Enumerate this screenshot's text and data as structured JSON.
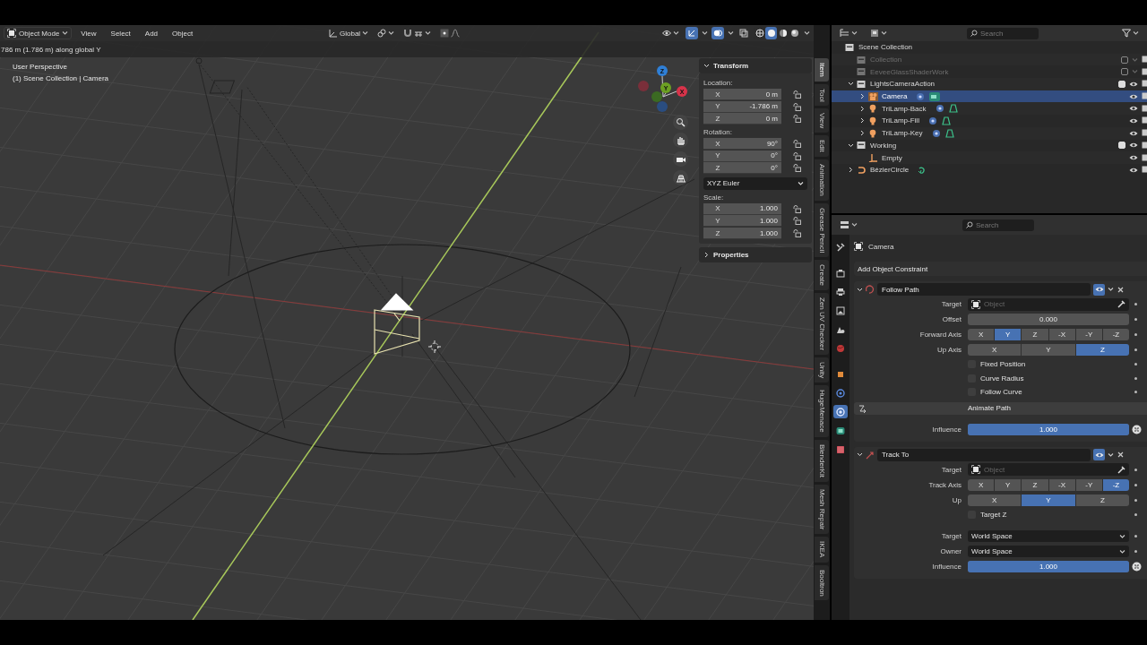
{
  "viewport_header": {
    "mode": "Object Mode",
    "menus": [
      "View",
      "Select",
      "Add",
      "Object"
    ],
    "orientation": "Global",
    "gizmos": {
      "on": true
    },
    "overlays": {
      "on": true
    },
    "xray": {
      "on": false
    },
    "shading": [
      {
        "kind": "wireframe",
        "selected": false
      },
      {
        "kind": "solid",
        "selected": true
      },
      {
        "kind": "material",
        "selected": false
      },
      {
        "kind": "rendered",
        "selected": false
      }
    ]
  },
  "viewport": {
    "operator_text": "786 m (1.786 m) along global Y",
    "view_name": "User Perspective",
    "view_context": "(1) Scene Collection | Camera",
    "gizmo_axes": [
      {
        "kind": "z",
        "label": "Z"
      },
      {
        "kind": "y",
        "label": "Y"
      },
      {
        "kind": "x",
        "label": "X"
      }
    ]
  },
  "transform_panel": {
    "title": "Transform",
    "expanded": true,
    "sections": [
      {
        "kind": "vector",
        "label": "Location:",
        "fields": [
          {
            "axis": "X",
            "value": "0 m",
            "locked": false
          },
          {
            "axis": "Y",
            "value": "-1.786 m",
            "locked": false
          },
          {
            "axis": "Z",
            "value": "0 m",
            "locked": false
          }
        ]
      },
      {
        "kind": "vector",
        "label": "Rotation:",
        "fields": [
          {
            "axis": "X",
            "value": "90°",
            "locked": false
          },
          {
            "axis": "Y",
            "value": "0°",
            "locked": false
          },
          {
            "axis": "Z",
            "value": "0°",
            "locked": false
          }
        ]
      },
      {
        "kind": "dropdown",
        "value": "XYZ Euler"
      },
      {
        "kind": "vector",
        "label": "Scale:",
        "fields": [
          {
            "axis": "X",
            "value": "1.000",
            "locked": false
          },
          {
            "axis": "Y",
            "value": "1.000",
            "locked": false
          },
          {
            "axis": "Z",
            "value": "1.000",
            "locked": false
          }
        ]
      }
    ]
  },
  "properties_panel": {
    "title": "Properties",
    "expanded": false
  },
  "sidebar_tabs": [
    {
      "label": "Item",
      "selected": true
    },
    {
      "label": "Tool",
      "selected": false
    },
    {
      "label": "View",
      "selected": false
    },
    {
      "label": "Edit",
      "selected": false
    },
    {
      "label": "Animation",
      "selected": false
    },
    {
      "label": "Grease Pencil",
      "selected": false
    },
    {
      "label": "Create",
      "selected": false
    },
    {
      "label": "Zen UV Checker",
      "selected": false
    },
    {
      "label": "Unity",
      "selected": false
    },
    {
      "label": "HugeMenace",
      "selected": false
    },
    {
      "label": "BlenderKit",
      "selected": false
    },
    {
      "label": "Mesh Repair",
      "selected": false
    },
    {
      "label": "IKEA",
      "selected": false
    },
    {
      "label": "Booltron",
      "selected": false
    }
  ],
  "outliner": {
    "search_placeholder": "Search",
    "root": "Scene Collection",
    "items": [
      {
        "name": "Collection",
        "kind": "collection",
        "excluded": true,
        "checked": false,
        "selected": false
      },
      {
        "name": "EeveeGlassShaderWork",
        "kind": "collection",
        "excluded": true,
        "checked": false,
        "selected": false
      },
      {
        "name": "LightsCameraAction",
        "kind": "collection",
        "excluded": false,
        "checked": true,
        "selected": false,
        "expanded": true,
        "children": [
          {
            "name": "Camera",
            "kind": "camera",
            "selected": true,
            "expanded": false
          },
          {
            "name": "TriLamp-Back",
            "kind": "light",
            "selected": false,
            "expanded": false
          },
          {
            "name": "TriLamp-Fill",
            "kind": "light",
            "selected": false,
            "expanded": false
          },
          {
            "name": "TriLamp-Key",
            "kind": "light",
            "selected": false,
            "expanded": false
          }
        ]
      },
      {
        "name": "Working",
        "kind": "collection",
        "excluded": false,
        "checked": true,
        "selected": false,
        "expanded": true,
        "children": [
          {
            "name": "Empty",
            "kind": "empty",
            "selected": false
          }
        ]
      },
      {
        "name": "BézierCircle",
        "kind": "curve",
        "selected": false,
        "expanded": false
      }
    ]
  },
  "properties": {
    "search_placeholder": "Search",
    "tabs": [
      {
        "kind": "tool",
        "selected": false
      },
      {
        "kind": "render",
        "selected": false
      },
      {
        "kind": "output",
        "selected": false
      },
      {
        "kind": "view_layer",
        "selected": false
      },
      {
        "kind": "scene",
        "selected": false
      },
      {
        "kind": "world",
        "selected": false
      },
      {
        "kind": "object",
        "selected": false
      },
      {
        "kind": "physics",
        "selected": false
      },
      {
        "kind": "constraints",
        "selected": true
      },
      {
        "kind": "data",
        "selected": false
      },
      {
        "kind": "texture",
        "selected": false
      }
    ],
    "object_name": "Camera",
    "add_button": "Add Object Constraint",
    "constraints": [
      {
        "kind": "follow_path",
        "name": "Follow Path",
        "expanded": true,
        "enabled": true,
        "rows": [
          {
            "kind": "target",
            "label": "Target",
            "placeholder": "Object"
          },
          {
            "kind": "number",
            "label": "Offset",
            "value": "0.000"
          },
          {
            "kind": "axis",
            "label": "Forward Axis",
            "options": [
              {
                "label": "X",
                "selected": false
              },
              {
                "label": "Y",
                "selected": true
              },
              {
                "label": "Z",
                "selected": false
              },
              {
                "label": "-X",
                "selected": false
              },
              {
                "label": "-Y",
                "selected": false
              },
              {
                "label": "-Z",
                "selected": false
              }
            ]
          },
          {
            "kind": "axis",
            "label": "Up Axis",
            "options": [
              {
                "label": "X",
                "selected": false
              },
              {
                "label": "Y",
                "selected": false
              },
              {
                "label": "Z",
                "selected": true
              }
            ]
          },
          {
            "kind": "checkbox",
            "label": "Fixed Position",
            "checked": false
          },
          {
            "kind": "checkbox",
            "label": "Curve Radius",
            "checked": false
          },
          {
            "kind": "checkbox",
            "label": "Follow Curve",
            "checked": false
          },
          {
            "kind": "button",
            "label": "Animate Path"
          },
          {
            "kind": "slider",
            "label": "Influence",
            "value": "1.000",
            "level": 1
          }
        ]
      },
      {
        "kind": "track_to",
        "name": "Track To",
        "expanded": true,
        "enabled": true,
        "rows": [
          {
            "kind": "target",
            "label": "Target",
            "placeholder": "Object"
          },
          {
            "kind": "axis",
            "label": "Track Axis",
            "options": [
              {
                "label": "X",
                "selected": false
              },
              {
                "label": "Y",
                "selected": false
              },
              {
                "label": "Z",
                "selected": false
              },
              {
                "label": "-X",
                "selected": false
              },
              {
                "label": "-Y",
                "selected": false
              },
              {
                "label": "-Z",
                "selected": true
              }
            ]
          },
          {
            "kind": "axis",
            "label": "Up",
            "options": [
              {
                "label": "X",
                "selected": false
              },
              {
                "label": "Y",
                "selected": true
              },
              {
                "label": "Z",
                "selected": false
              }
            ]
          },
          {
            "kind": "checkbox",
            "label": "Target Z",
            "checked": false
          },
          {
            "kind": "dropdown",
            "label": "Target",
            "value": "World Space"
          },
          {
            "kind": "dropdown",
            "label": "Owner",
            "value": "World Space"
          },
          {
            "kind": "slider",
            "label": "Influence",
            "value": "1.000",
            "level": 1
          }
        ]
      }
    ]
  }
}
